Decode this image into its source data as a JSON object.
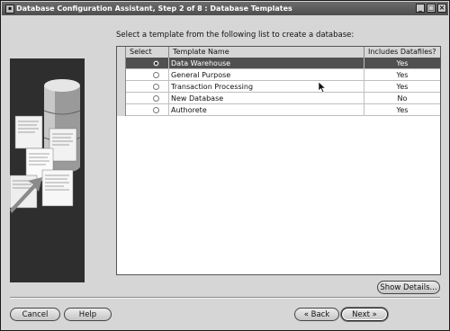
{
  "window": {
    "title": "Database Configuration Assistant, Step 2 of 8 : Database Templates",
    "icon_glyph": "▪",
    "minimize_glyph": "_",
    "maximize_glyph": "□",
    "close_glyph": "×"
  },
  "prompt": "Select a template from the following list to create a database:",
  "table": {
    "columns": [
      "Select",
      "Template Name",
      "Includes Datafiles?"
    ],
    "rows": [
      {
        "selected": true,
        "name": "Data Warehouse",
        "includes_datafiles": "Yes"
      },
      {
        "selected": false,
        "name": "General Purpose",
        "includes_datafiles": "Yes"
      },
      {
        "selected": false,
        "name": "Transaction Processing",
        "includes_datafiles": "Yes"
      },
      {
        "selected": false,
        "name": "New Database",
        "includes_datafiles": "No"
      },
      {
        "selected": false,
        "name": "Authorete",
        "includes_datafiles": "Yes"
      }
    ]
  },
  "buttons": {
    "show_details": "Show Details...",
    "cancel": "Cancel",
    "help": "Help",
    "back": "Back",
    "next": "Next",
    "back_glyph": "«",
    "next_glyph": "»"
  },
  "colors": {
    "selected_row": "#505050",
    "dialog_bg": "#d6d6d6"
  },
  "icons": {
    "art": "database-documents-illustration",
    "cursor": "mouse-pointer-icon"
  }
}
